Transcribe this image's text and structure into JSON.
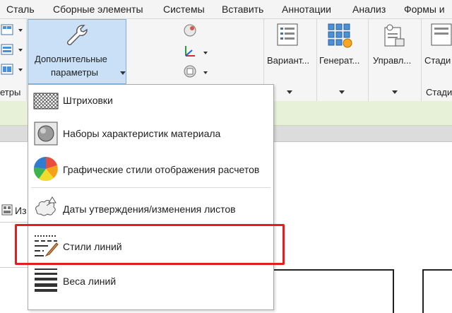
{
  "menu": {
    "items": [
      "Сталь",
      "Сборные элементы",
      "Системы",
      "Вставить",
      "Аннотации",
      "Анализ",
      "Формы и"
    ]
  },
  "ribbon": {
    "left_label": "етры",
    "dop_button_line1": "Дополнительные",
    "dop_button_line2": "параметры",
    "variant_label": "Вариант...",
    "generate_label": "Генерат...",
    "manage_label": "Управл...",
    "stage_label": "Стади",
    "stage_label2": "Стади"
  },
  "side": {
    "partial_label": "Из"
  },
  "dropdown": {
    "items": [
      {
        "label": "Штриховки",
        "icon": "hatch-icon"
      },
      {
        "label": "Наборы характеристик материала",
        "icon": "material-sphere-icon"
      },
      {
        "label": "Графические стили отображения расчетов",
        "icon": "color-wheel-icon"
      },
      {
        "label": "Даты утверждения/изменения листов",
        "icon": "revision-cloud-icon"
      },
      {
        "label": "Стили линий",
        "icon": "line-styles-icon"
      },
      {
        "label": "Веса линий",
        "icon": "line-weights-icon"
      }
    ]
  },
  "colors": {
    "highlight": "#e81c1c",
    "button_active": "#c9e0f7",
    "green_strip": "#e7f1d8"
  }
}
